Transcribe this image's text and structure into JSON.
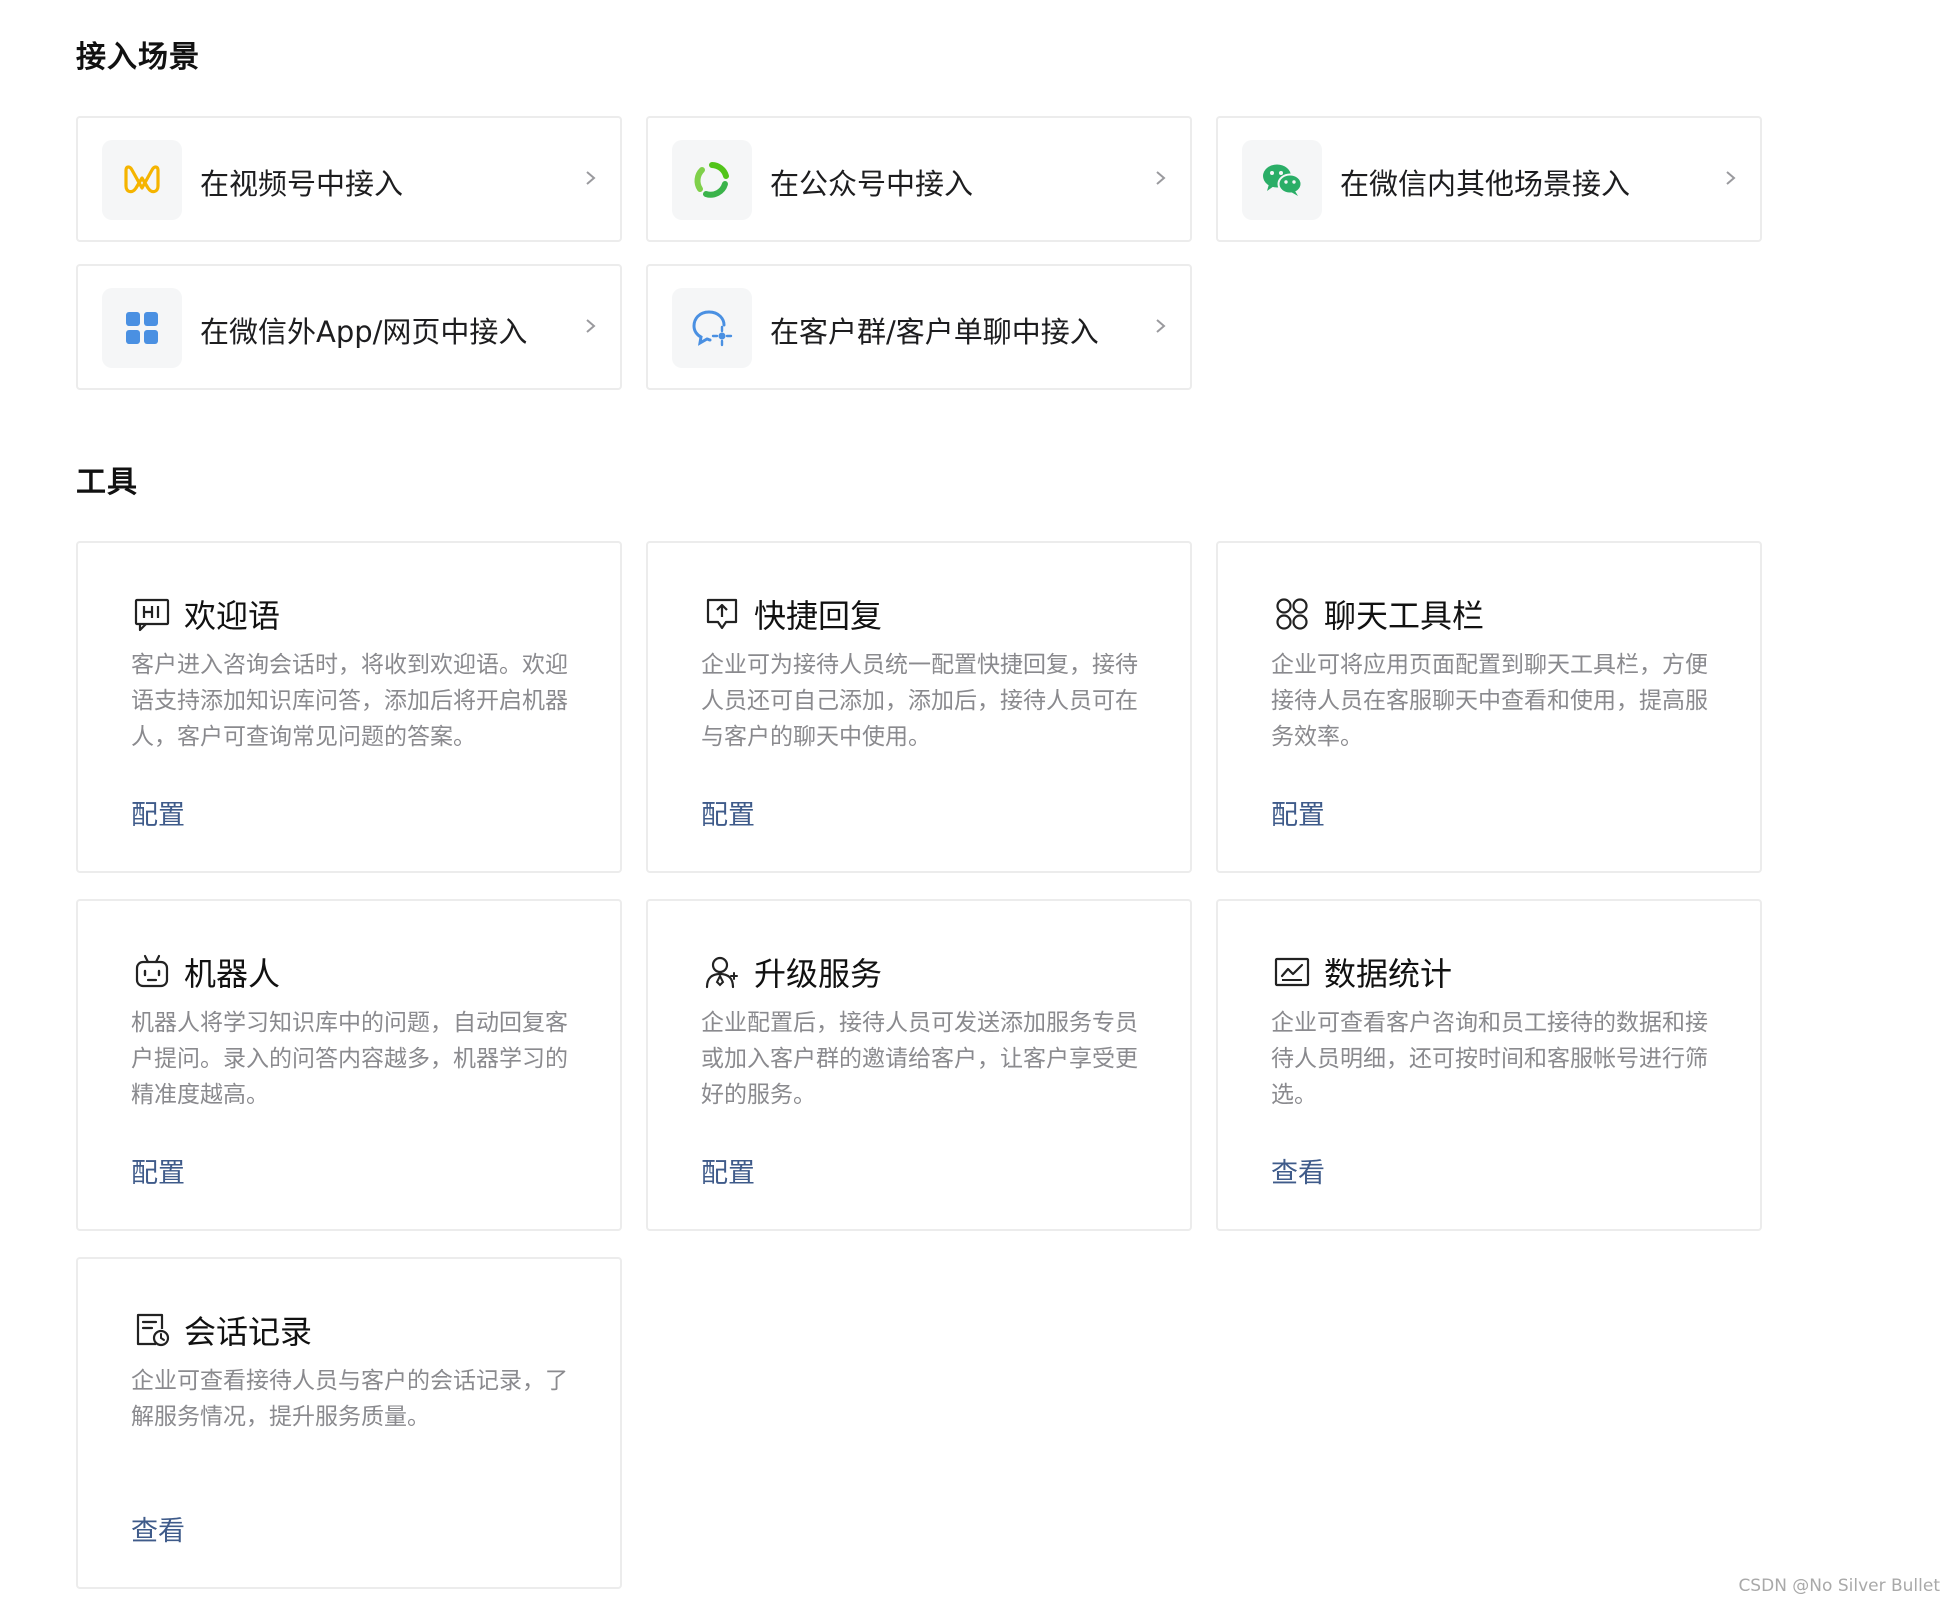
{
  "sections": {
    "scenes_title": "接入场景",
    "tools_title": "工具"
  },
  "scenes": [
    {
      "label": "在视频号中接入",
      "icon": "channels-icon",
      "color": "#f5b400"
    },
    {
      "label": "在公众号中接入",
      "icon": "official-account-icon",
      "color": "#52c41a"
    },
    {
      "label": "在微信内其他场景接入",
      "icon": "wechat-icon",
      "color": "#2aae67"
    },
    {
      "label": "在微信外App/网页中接入",
      "icon": "app-grid-icon",
      "color": "#4a90e2"
    },
    {
      "label": "在客户群/客户单聊中接入",
      "icon": "customer-chat-icon",
      "color": "#4a90e2"
    }
  ],
  "tools": [
    {
      "title": "欢迎语",
      "icon": "hi-icon",
      "desc": "客户进入咨询会话时，将收到欢迎语。欢迎语支持添加知识库问答，添加后将开启机器人，客户可查询常见问题的答案。",
      "link": "配置"
    },
    {
      "title": "快捷回复",
      "icon": "quick-reply-icon",
      "desc": "企业可为接待人员统一配置快捷回复，接待人员还可自己添加，添加后，接待人员可在与客户的聊天中使用。",
      "link": "配置"
    },
    {
      "title": "聊天工具栏",
      "icon": "toolbar-icon",
      "desc": "企业可将应用页面配置到聊天工具栏，方便接待人员在客服聊天中查看和使用，提高服务效率。",
      "link": "配置"
    },
    {
      "title": "机器人",
      "icon": "robot-icon",
      "desc": "机器人将学习知识库中的问题，自动回复客户提问。录入的问答内容越多，机器学习的精准度越高。",
      "link": "配置"
    },
    {
      "title": "升级服务",
      "icon": "upgrade-service-icon",
      "desc": "企业配置后，接待人员可发送添加服务专员或加入客户群的邀请给客户，让客户享受更好的服务。",
      "link": "配置"
    },
    {
      "title": "数据统计",
      "icon": "statistics-icon",
      "desc": "企业可查看客户咨询和员工接待的数据和接待人员明细，还可按时间和客服帐号进行筛选。",
      "link": "查看"
    },
    {
      "title": "会话记录",
      "icon": "chat-record-icon",
      "desc": "企业可查看接待人员与客户的会话记录，了解服务情况，提升服务质量。",
      "link": "查看"
    }
  ],
  "watermark": "CSDN @No Silver Bullet"
}
